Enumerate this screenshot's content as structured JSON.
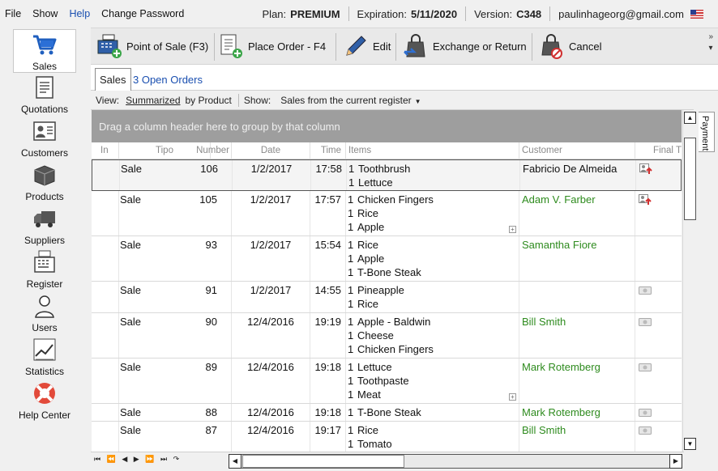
{
  "menu": {
    "file": "File",
    "show": "Show",
    "help": "Help",
    "change_password": "Change Password"
  },
  "plan": {
    "plan_label": "Plan:",
    "plan_value": "PREMIUM",
    "expiration_label": "Expiration:",
    "expiration_value": "5/11/2020",
    "version_label": "Version:",
    "version_value": "C348",
    "email": "paulinhageorg@gmail.com"
  },
  "nav": {
    "items": [
      {
        "label": "Sales",
        "icon": "cart-icon"
      },
      {
        "label": "Quotations",
        "icon": "document-icon"
      },
      {
        "label": "Customers",
        "icon": "id-card-icon"
      },
      {
        "label": "Products",
        "icon": "boxes-icon"
      },
      {
        "label": "Suppliers",
        "icon": "truck-icon"
      },
      {
        "label": "Register",
        "icon": "cash-register-icon"
      },
      {
        "label": "Users",
        "icon": "user-icon"
      },
      {
        "label": "Statistics",
        "icon": "chart-icon"
      },
      {
        "label": "Help Center",
        "icon": "lifebuoy-icon"
      }
    ]
  },
  "toolbar": {
    "point_of_sale": "Point of Sale (F3)",
    "place_order": "Place Order - F4",
    "edit": "Edit",
    "exchange_return": "Exchange or Return",
    "cancel": "Cancel",
    "more": "»"
  },
  "tabs": {
    "sales": "Sales",
    "open_orders": "3 Open Orders"
  },
  "view": {
    "view_label": "View:",
    "view_value": "Summarized",
    "by_product": "by Product",
    "show_label": "Show:",
    "show_value": "Sales from the current register"
  },
  "group_panel": "Drag a column header here to group by that column",
  "columns": {
    "in": "In",
    "tipo": "Tipo",
    "number": "Number",
    "date": "Date",
    "time": "Time",
    "items": "Items",
    "customer": "Customer",
    "final_total": "Final T"
  },
  "rows": [
    {
      "tipo": "Sale",
      "number": "106",
      "date": "1/2/2017",
      "time": "17:58",
      "items": [
        {
          "q": "1",
          "name": "Toothbrush"
        },
        {
          "q": "1",
          "name": "Lettuce"
        }
      ],
      "customer": "Fabricio De Almeida",
      "customer_color": "black",
      "status_icon": "user-arrow-icon",
      "more": false
    },
    {
      "tipo": "Sale",
      "number": "105",
      "date": "1/2/2017",
      "time": "17:57",
      "items": [
        {
          "q": "1",
          "name": "Chicken Fingers"
        },
        {
          "q": "1",
          "name": "Rice"
        },
        {
          "q": "1",
          "name": "Apple"
        }
      ],
      "customer": "Adam V. Farber",
      "customer_color": "green",
      "status_icon": "user-arrow-icon",
      "more": true
    },
    {
      "tipo": "Sale",
      "number": "93",
      "date": "1/2/2017",
      "time": "15:54",
      "items": [
        {
          "q": "1",
          "name": "Rice"
        },
        {
          "q": "1",
          "name": "Apple"
        },
        {
          "q": "1",
          "name": "T-Bone Steak"
        }
      ],
      "customer": "Samantha Fiore",
      "customer_color": "green",
      "status_icon": "",
      "more": false
    },
    {
      "tipo": "Sale",
      "number": "91",
      "date": "1/2/2017",
      "time": "14:55",
      "items": [
        {
          "q": "1",
          "name": "Pineapple"
        },
        {
          "q": "1",
          "name": "Rice"
        }
      ],
      "customer": "",
      "customer_color": "green",
      "status_icon": "cash-icon",
      "more": false
    },
    {
      "tipo": "Sale",
      "number": "90",
      "date": "12/4/2016",
      "time": "19:19",
      "items": [
        {
          "q": "1",
          "name": "Apple - Baldwin"
        },
        {
          "q": "1",
          "name": "Cheese"
        },
        {
          "q": "1",
          "name": "Chicken Fingers"
        }
      ],
      "customer": "Bill Smith",
      "customer_color": "green",
      "status_icon": "cash-icon",
      "more": false
    },
    {
      "tipo": "Sale",
      "number": "89",
      "date": "12/4/2016",
      "time": "19:18",
      "items": [
        {
          "q": "1",
          "name": "Lettuce"
        },
        {
          "q": "1",
          "name": "Toothpaste"
        },
        {
          "q": "1",
          "name": "Meat"
        }
      ],
      "customer": "Mark Rotemberg",
      "customer_color": "green",
      "status_icon": "cash-icon",
      "more": true
    },
    {
      "tipo": "Sale",
      "number": "88",
      "date": "12/4/2016",
      "time": "19:18",
      "items": [
        {
          "q": "1",
          "name": "T-Bone Steak"
        }
      ],
      "customer": "Mark Rotemberg",
      "customer_color": "green",
      "status_icon": "cash-icon",
      "more": false
    },
    {
      "tipo": "Sale",
      "number": "87",
      "date": "12/4/2016",
      "time": "19:17",
      "items": [
        {
          "q": "1",
          "name": "Rice"
        },
        {
          "q": "1",
          "name": "Tomato"
        }
      ],
      "customer": "Bill Smith",
      "customer_color": "green",
      "status_icon": "cash-icon",
      "more": false
    }
  ],
  "side_tab": "Payment",
  "record_nav": [
    "⏮",
    "⏪",
    "◀",
    "▶",
    "⏩",
    "⏭",
    "↷"
  ]
}
